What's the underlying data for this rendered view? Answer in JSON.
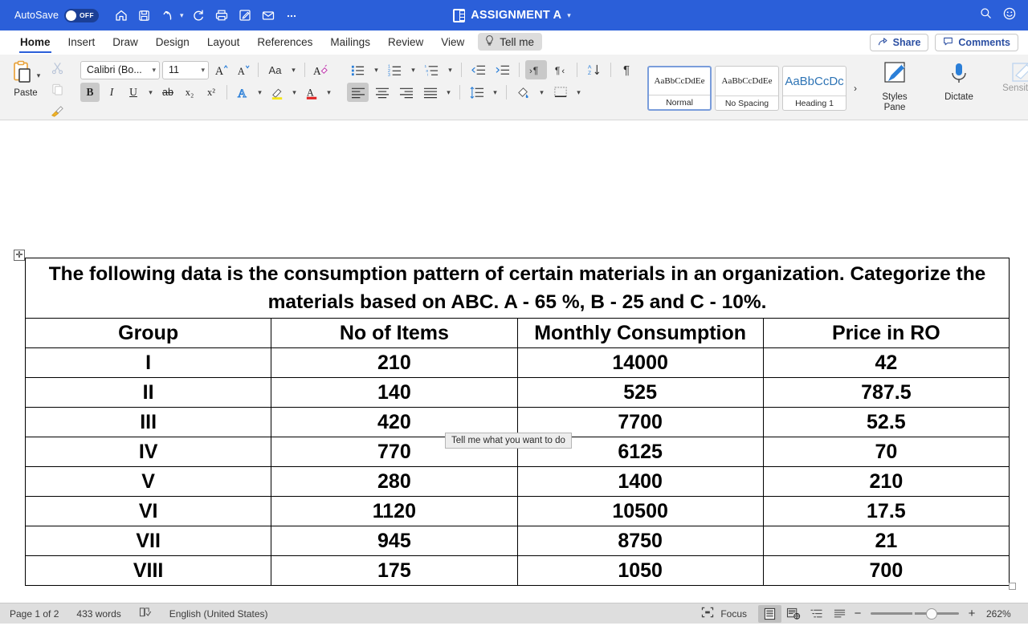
{
  "titlebar": {
    "autosave_label": "AutoSave",
    "autosave_state": "OFF",
    "document_title": "ASSIGNMENT A",
    "icons": [
      "home-icon",
      "save-icon",
      "undo-icon",
      "undo-caret-icon",
      "redo-icon",
      "print-icon",
      "edit-icon",
      "mail-icon",
      "more-icon"
    ],
    "right_icons": [
      "search-icon",
      "smiley-icon"
    ],
    "accent_color": "#2b5fd9"
  },
  "tabs": {
    "items": [
      {
        "label": "Home",
        "active": true
      },
      {
        "label": "Insert",
        "active": false
      },
      {
        "label": "Draw",
        "active": false
      },
      {
        "label": "Design",
        "active": false
      },
      {
        "label": "Layout",
        "active": false
      },
      {
        "label": "References",
        "active": false
      },
      {
        "label": "Mailings",
        "active": false
      },
      {
        "label": "Review",
        "active": false
      },
      {
        "label": "View",
        "active": false
      }
    ],
    "tell_me": "Tell me",
    "share": "Share",
    "comments": "Comments"
  },
  "ribbon": {
    "paste_label": "Paste",
    "font_name": "Calibri (Bo...",
    "font_size": "11",
    "bold": "B",
    "italic": "I",
    "underline": "U",
    "strikethrough": "ab",
    "subscript": "x₂",
    "superscript": "x²",
    "change_case": "Aa",
    "styles": [
      {
        "preview": "AaBbCcDdEe",
        "name": "Normal",
        "selected": true
      },
      {
        "preview": "AaBbCcDdEe",
        "name": "No Spacing",
        "selected": false
      },
      {
        "preview": "AaBbCcDc",
        "name": "Heading 1",
        "selected": false
      }
    ],
    "gallery_more": "›",
    "styles_pane": "Styles\nPane",
    "styles_pane_line1": "Styles",
    "styles_pane_line2": "Pane",
    "dictate": "Dictate",
    "sensitivity": "Sensitivity"
  },
  "document": {
    "title_text": "The following data is the consumption pattern of certain materials in an organization. Categorize the materials based on ABC. A - 65 %, B - 25 and C - 10%.",
    "table": {
      "headers": [
        "Group",
        "No of Items",
        "Monthly Consumption",
        "Price in RO"
      ],
      "rows": [
        [
          "I",
          "210",
          "14000",
          "42"
        ],
        [
          "II",
          "140",
          "525",
          "787.5"
        ],
        [
          "III",
          "420",
          "7700",
          "52.5"
        ],
        [
          "IV",
          "770",
          "6125",
          "70"
        ],
        [
          "V",
          "280",
          "1400",
          "210"
        ],
        [
          "VI",
          "1120",
          "10500",
          "17.5"
        ],
        [
          "VII",
          "945",
          "8750",
          "21"
        ],
        [
          "VIII",
          "175",
          "1050",
          "700"
        ]
      ]
    },
    "tooltip": "Tell me what you want to do"
  },
  "status": {
    "page": "Page 1 of 2",
    "words": "433 words",
    "proofing_icon": "proofing-icon",
    "language": "English (United States)",
    "focus": "Focus",
    "zoom_out": "−",
    "zoom_in": "+",
    "zoom_value": "262%"
  }
}
